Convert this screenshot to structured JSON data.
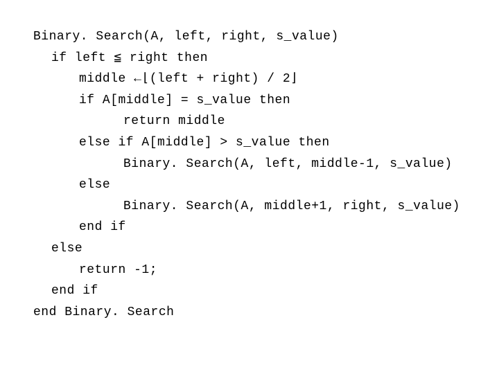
{
  "pseudocode": {
    "line1": "Binary. Search(A, left, right, s_value)",
    "line2": "if left ≦ right then",
    "line3": "middle ←⌊(left + right) / 2⌋",
    "line4": "if A[middle] = s_value then",
    "line5": "return middle",
    "line6": "else if A[middle] > s_value then",
    "line7": "Binary. Search(A, left, middle-1, s_value)",
    "line8": "else",
    "line9": "Binary. Search(A, middle+1, right, s_value)",
    "line10": "end if",
    "line11": "else",
    "line12": "return -1;",
    "line13": "end if",
    "line14": "end Binary. Search"
  }
}
